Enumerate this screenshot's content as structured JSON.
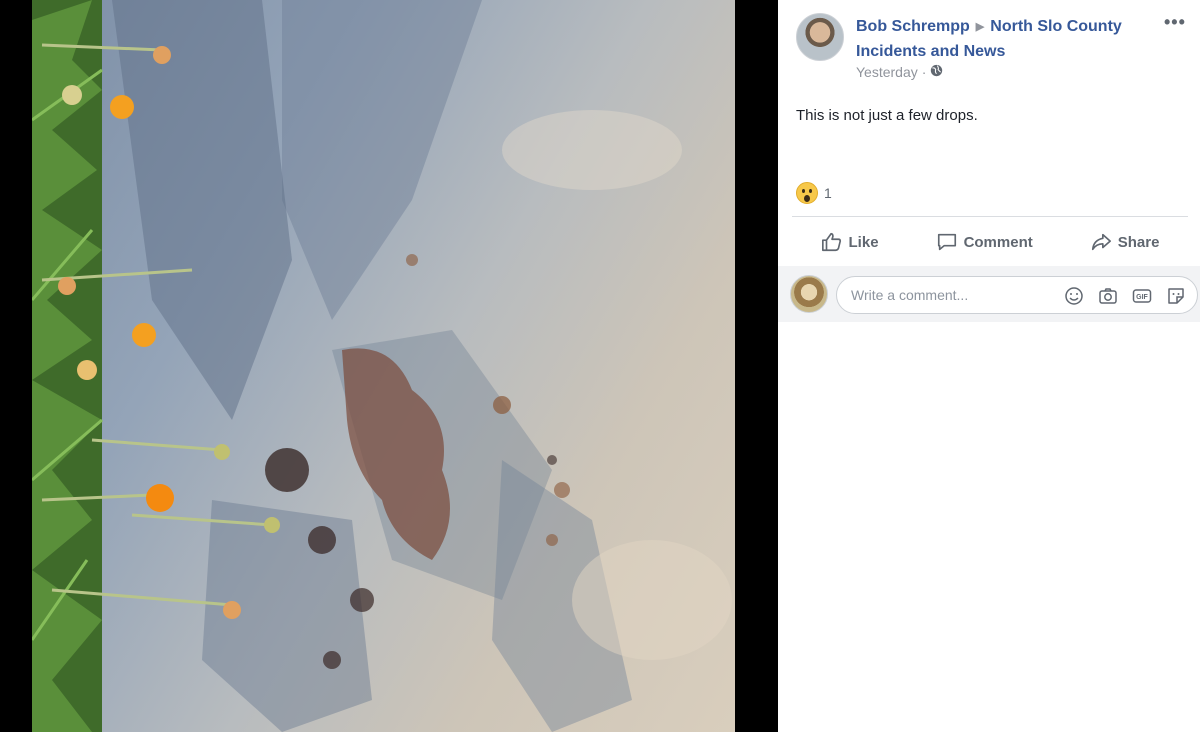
{
  "post": {
    "author": "Bob Schrempp",
    "group": "North Slo County Incidents and News",
    "timestamp": "Yesterday",
    "audience_icon": "globe-icon",
    "text": "This is not just a few drops.",
    "reaction_count": "1",
    "reaction_icon": "wow-icon"
  },
  "actions": {
    "like": "Like",
    "comment": "Comment",
    "share": "Share"
  },
  "comment_box": {
    "placeholder": "Write a comment..."
  },
  "colors": {
    "link_blue": "#365899",
    "meta_gray": "#90949c",
    "action_gray": "#606770"
  }
}
